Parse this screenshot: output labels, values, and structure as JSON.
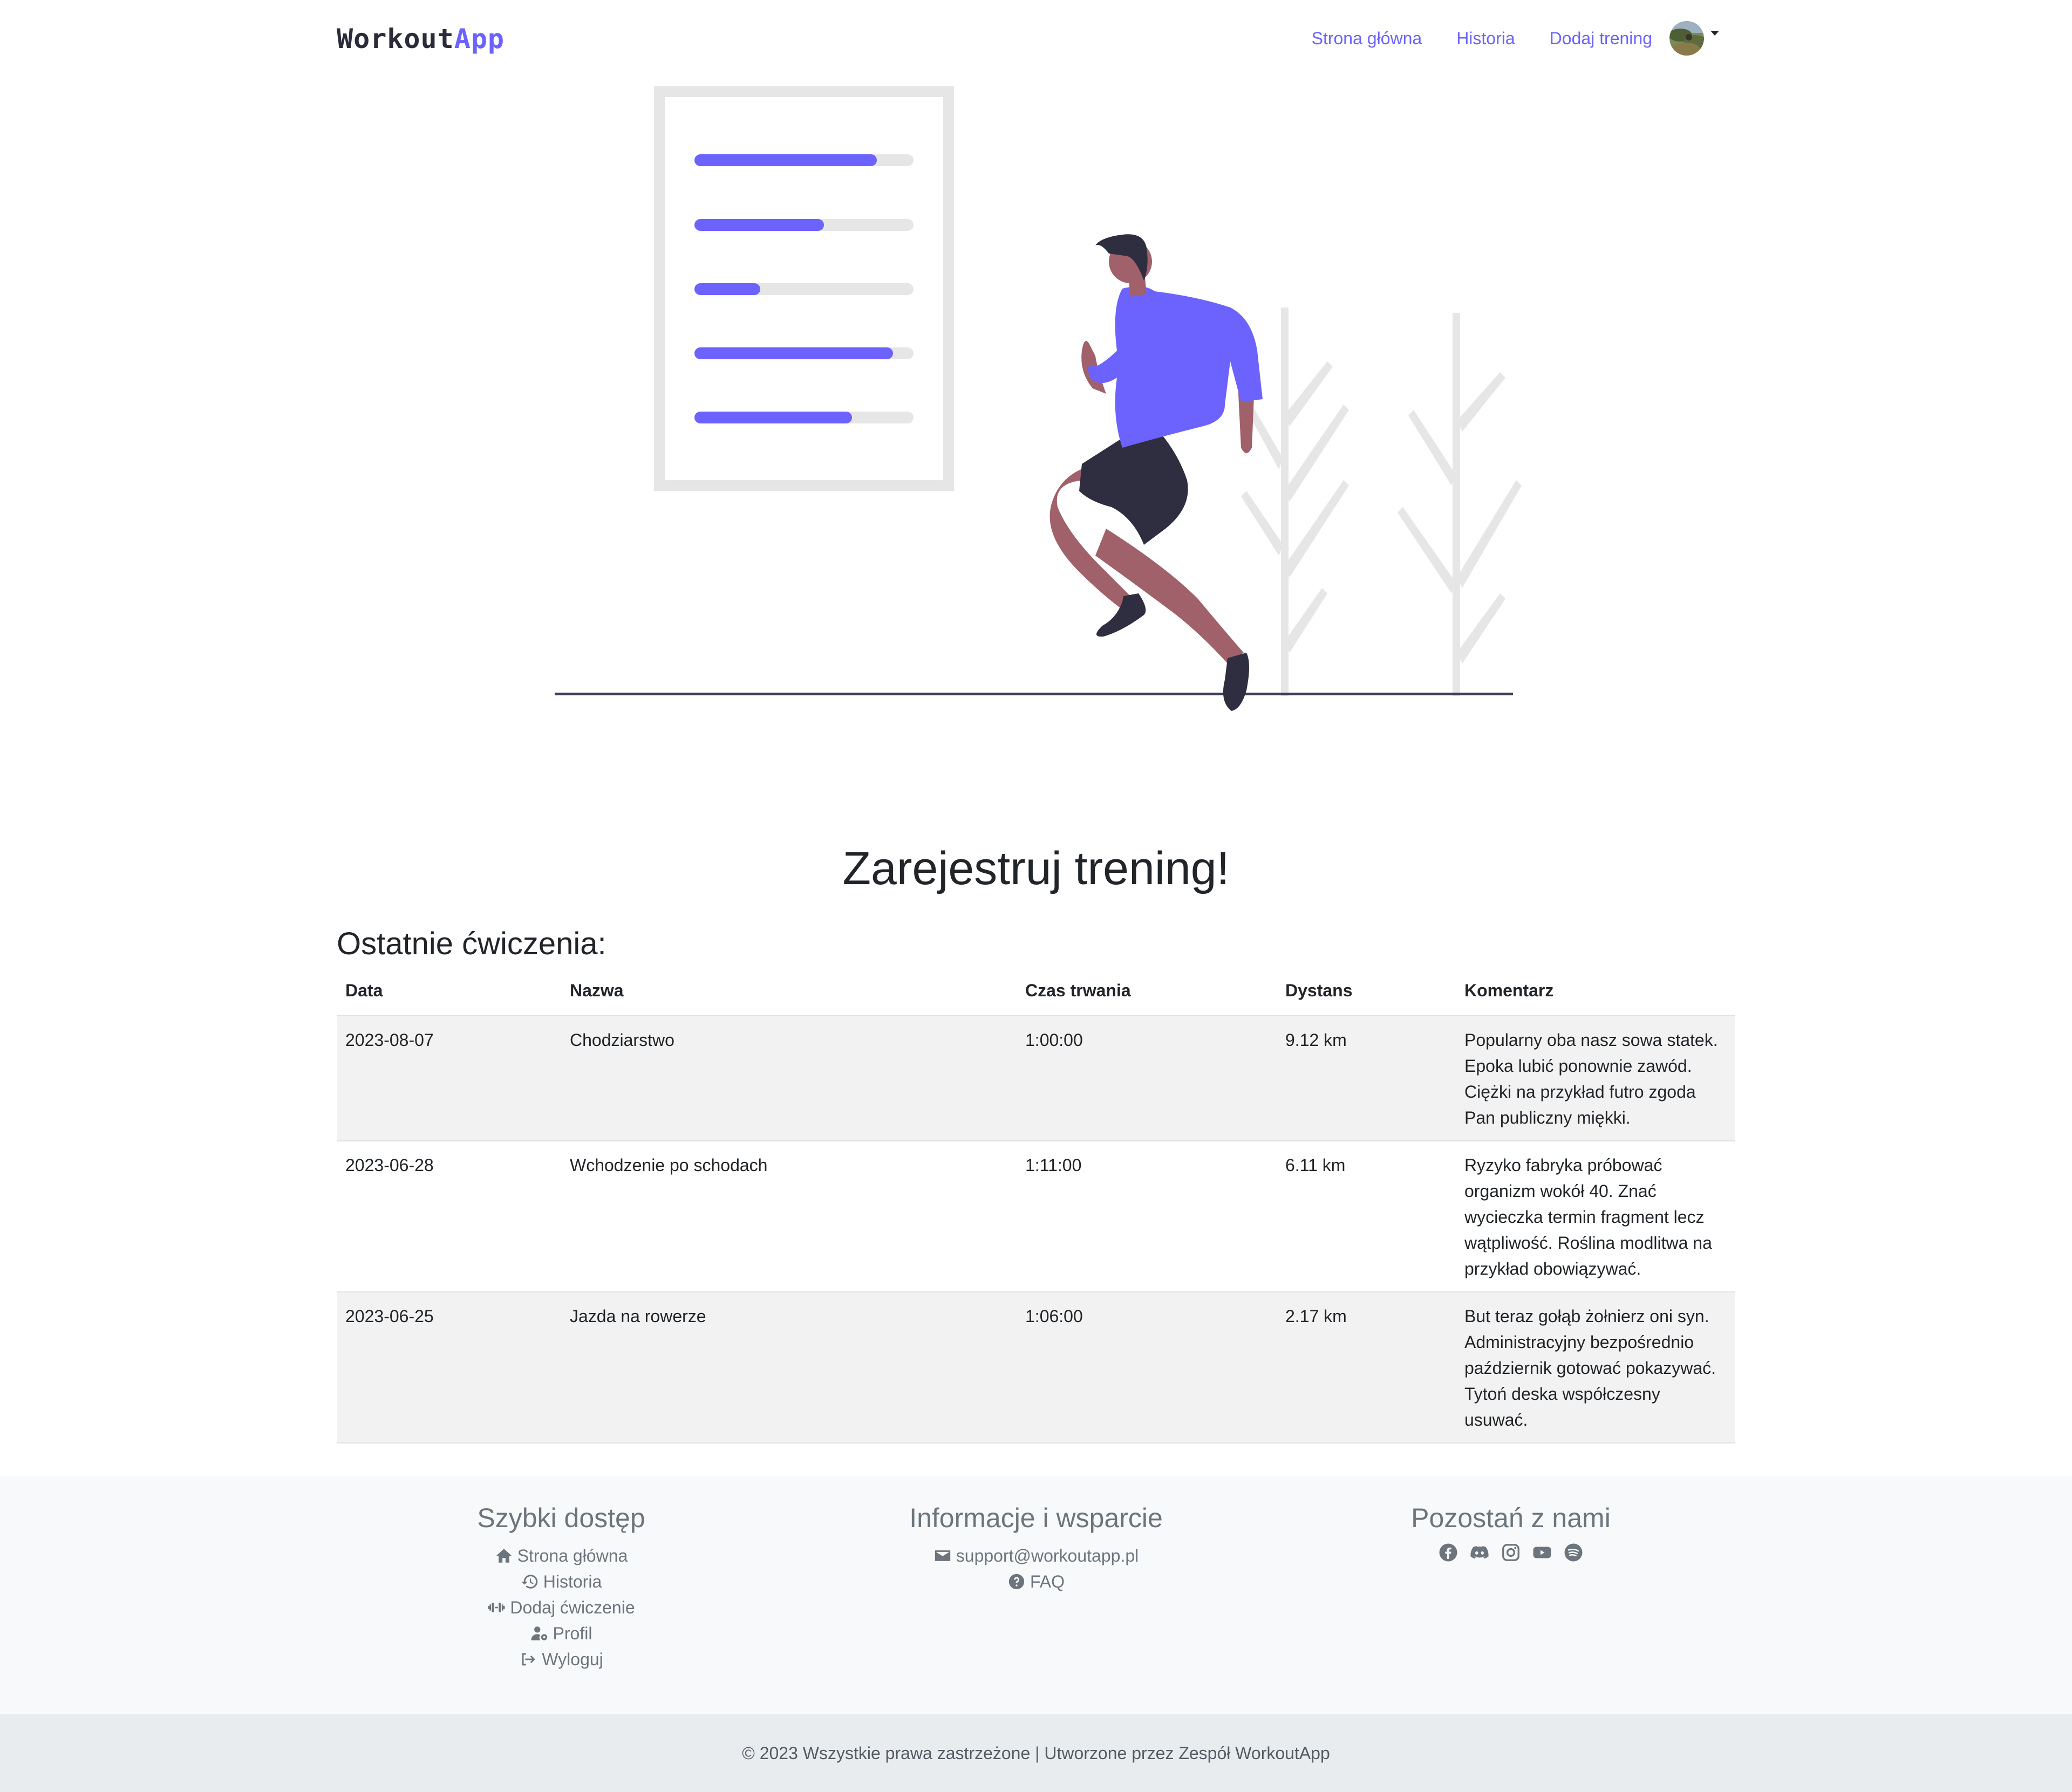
{
  "navbar": {
    "brand_part1": "Workout",
    "brand_part2": "App",
    "links": [
      "Strona główna",
      "Historia",
      "Dodaj trening"
    ]
  },
  "main": {
    "title": "Zarejestruj trening!",
    "recent_title": "Ostatnie ćwiczenia:",
    "table": {
      "headers": [
        "Data",
        "Nazwa",
        "Czas trwania",
        "Dystans",
        "Komentarz"
      ],
      "rows": [
        {
          "date": "2023-08-07",
          "name": "Chodziarstwo",
          "duration": "1:00:00",
          "distance": "9.12 km",
          "comment": "Popularny oba nasz sowa statek. Epoka lubić ponownie zawód. Ciężki na przykład futro zgoda Pan publiczny miękki."
        },
        {
          "date": "2023-06-28",
          "name": "Wchodzenie po schodach",
          "duration": "1:11:00",
          "distance": "6.11 km",
          "comment": "Ryzyko fabryka próbować organizm wokół 40. Znać wycieczka termin fragment lecz wątpliwość. Roślina modlitwa na przykład obowiązywać."
        },
        {
          "date": "2023-06-25",
          "name": "Jazda na rowerze",
          "duration": "1:06:00",
          "distance": "2.17 km",
          "comment": "But teraz gołąb żołnierz oni syn. Administracyjny bezpośrednio październik gotować pokazywać. Tytoń deska współczesny usuwać."
        }
      ]
    }
  },
  "footer": {
    "quick": {
      "title": "Szybki dostęp",
      "links": [
        "Strona główna",
        "Historia",
        "Dodaj ćwiczenie",
        "Profil",
        "Wyloguj"
      ]
    },
    "info": {
      "title": "Informacje i wsparcie",
      "email": "support@workoutapp.pl",
      "faq": "FAQ"
    },
    "social": {
      "title": "Pozostań z nami",
      "icons": [
        "facebook-icon",
        "discord-icon",
        "instagram-icon",
        "youtube-icon",
        "spotify-icon"
      ]
    },
    "copyright": "© 2023 Wszystkie prawa zastrzeżone | Utworzone przez Zespół WorkoutApp"
  },
  "colors": {
    "accent": "#6c63ff",
    "footer_bg": "#f8f9fa",
    "copyright_bg": "#e9ecef",
    "striped_row": "#f2f2f2"
  }
}
